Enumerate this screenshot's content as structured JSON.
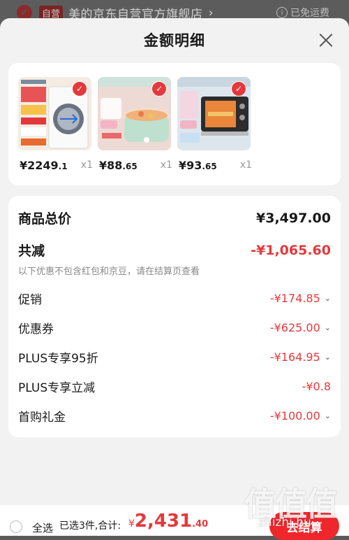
{
  "store": {
    "self_tag": "自营",
    "name": "美的京东自营官方旗舰店",
    "chevron": "›",
    "shipping": "已免运费",
    "check_glyph": "✓",
    "info_glyph": "i"
  },
  "sheet": {
    "title": "金额明细"
  },
  "products": [
    {
      "price_main": "¥2249",
      "price_dec": ".1",
      "qty": "x1",
      "image": "front-load-washer"
    },
    {
      "price_main": "¥88",
      "price_dec": ".65",
      "qty": "x1",
      "image": "electric-cooking-pot"
    },
    {
      "price_main": "¥93",
      "price_dec": ".65",
      "qty": "x1",
      "image": "toaster-oven"
    }
  ],
  "summary": {
    "subtotal_label": "商品总价",
    "subtotal_value": "¥3,497.00",
    "discount_label": "共减",
    "discount_value": "-¥1,065.60",
    "note": "以下优惠不包含红包和京豆，请在结算页查看",
    "items": [
      {
        "label": "促销",
        "value": "-¥174.85",
        "expandable": true
      },
      {
        "label": "优惠券",
        "value": "-¥625.00",
        "expandable": true
      },
      {
        "label": "PLUS专享95折",
        "value": "-¥164.95",
        "expandable": true
      },
      {
        "label": "PLUS专享立减",
        "value": "-¥0.8",
        "expandable": false
      },
      {
        "label": "首购礼金",
        "value": "-¥100.00",
        "expandable": true
      }
    ]
  },
  "bottom": {
    "select_all": "全选",
    "selected_text": "已选3件,合计:",
    "total_currency": "¥",
    "total_int": "2,431",
    "total_dec": ".40",
    "checkout": "去结算"
  },
  "watermark": {
    "glyphs": "值值值",
    "site": "zhizhi.hu"
  },
  "colors": {
    "accent_red": "#e4393c",
    "button_red": "#f0262d",
    "sheet_bg": "#f2f2f2"
  }
}
